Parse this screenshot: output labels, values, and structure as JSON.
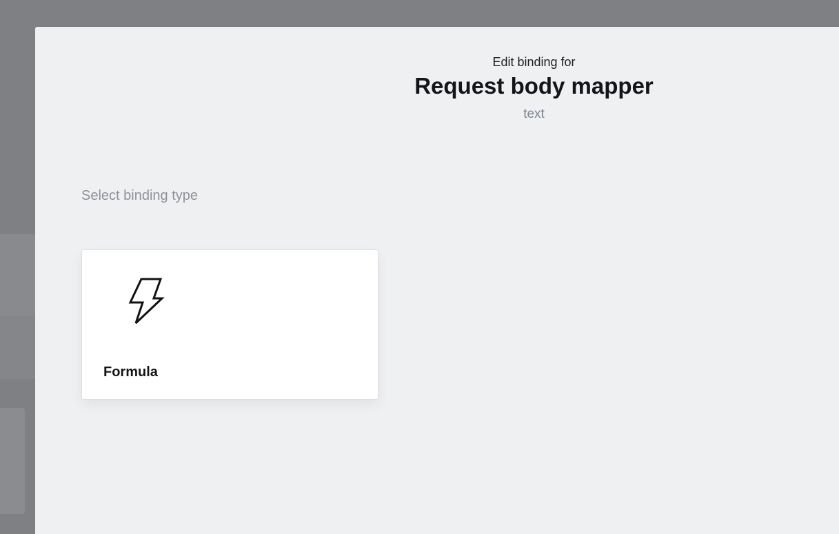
{
  "modal": {
    "eyebrow": "Edit binding for",
    "title": "Request body mapper",
    "subtitle": "text",
    "section_label": "Select binding type"
  },
  "binding_types": [
    {
      "label": "Formula",
      "icon": "lightning-bolt-icon"
    }
  ]
}
